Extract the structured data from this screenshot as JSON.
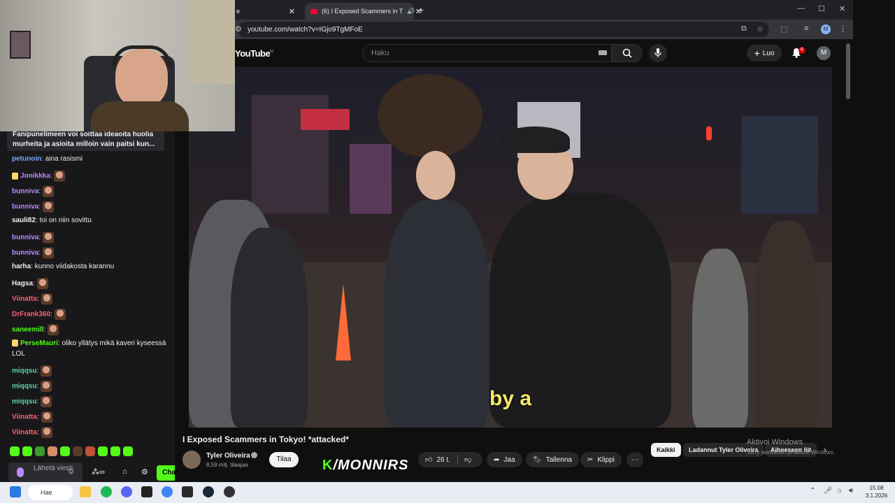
{
  "browser": {
    "tabs": [
      {
        "label": "e"
      },
      {
        "label": "(6) I Exposed Scammers in T",
        "active": true
      }
    ],
    "url": "youtube.com/watch?v=IGjo9TgMFoE"
  },
  "youtube": {
    "logo": "YouTube",
    "region": "FI",
    "search_placeholder": "Haku",
    "create_label": "Luo",
    "notification_count": "6",
    "avatar_letter": "M",
    "subtitle": "by a",
    "video_title": "I Exposed Scammers in Tokyo! *attacked*",
    "channel_name": "Tyler Oliveira",
    "subscribers": "8,59 milj. tilaajaa",
    "subscribe_label": "Tilaa",
    "like_count": "26 t.",
    "share_label": "Jaa",
    "save_label": "Tallenna",
    "clip_label": "Klippi",
    "chips": [
      "Kaikki",
      "Ladannut Tyler Oliveira",
      "Aiheeseen liit"
    ]
  },
  "windows": {
    "activate_title": "Aktivoi Windows",
    "activate_sub": "Siirry asetuksiin ja aktivoi Windows.",
    "search_label": "Hae",
    "time": "15.08",
    "date": "3.1.2026"
  },
  "chat": {
    "pinned": "Fanipunelimeen voi soittaa ideaoita huolia murheita ja asioita milloin vain paitsi kun...",
    "messages": [
      {
        "user": "petunoin",
        "text": "aina rasismi",
        "color": "#7aa9ff"
      },
      {
        "user": "Jonikkka",
        "text": "",
        "color": "#b98aff",
        "emote": true,
        "gift": true
      },
      {
        "user": "bunniva",
        "text": "",
        "color": "#b98aff",
        "emote": true
      },
      {
        "user": "bunniva",
        "text": "",
        "color": "#b98aff",
        "emote": true
      },
      {
        "user": "sauli82",
        "text": "toi on niin sovittu",
        "color": "#efeff1"
      },
      {
        "user": "bunniva",
        "text": "",
        "color": "#b98aff",
        "emote": true
      },
      {
        "user": "bunniva",
        "text": "",
        "color": "#b98aff",
        "emote": true
      },
      {
        "user": "harha",
        "text": "kunno viidakosta karannu",
        "color": "#efeff1"
      },
      {
        "user": "Hagsa",
        "text": "",
        "color": "#efeff1",
        "emote": true
      },
      {
        "user": "Viinatta",
        "text": "",
        "color": "#ff5f6d",
        "emote": true
      },
      {
        "user": "DrFrank360",
        "text": "",
        "color": "#ff5f6d",
        "emote": true
      },
      {
        "user": "saneemill",
        "text": "",
        "color": "#53fc18",
        "emote": true
      },
      {
        "user": "PerseMauri",
        "text": "oliko yllätys mikä kaveri kyseessä",
        "color": "#53fc18",
        "gift": true
      },
      {
        "user": "",
        "text": "LOL",
        "color": "#efeff1"
      },
      {
        "user": "miqqsu",
        "text": "",
        "color": "#5ad6a0",
        "emote": true
      },
      {
        "user": "miqqsu",
        "text": "",
        "color": "#5ad6a0",
        "emote": true
      },
      {
        "user": "miqqsu",
        "text": "",
        "color": "#5ad6a0",
        "emote": true
      },
      {
        "user": "Viinatta",
        "text": "",
        "color": "#ff5f6d",
        "emote": true
      },
      {
        "user": "Viinatta",
        "text": "",
        "color": "#ff5f6d",
        "emote": true
      }
    ],
    "input_placeholder": "Lähetä viesti",
    "send_label": "Chat"
  },
  "overlay": {
    "kick_user": "/MONNIRS"
  }
}
